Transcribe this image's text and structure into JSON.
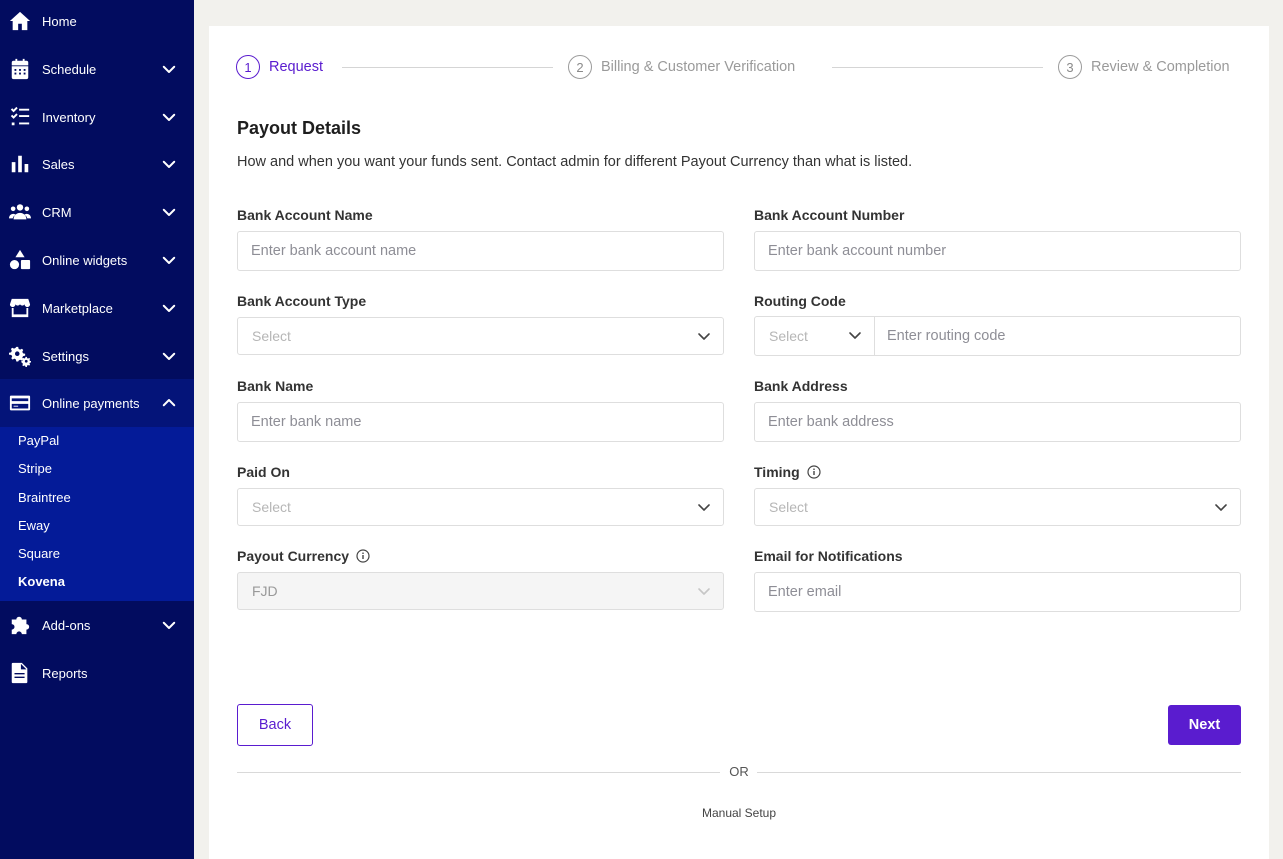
{
  "sidebar": {
    "items": [
      {
        "label": "Home",
        "icon": "home-icon"
      },
      {
        "label": "Schedule",
        "icon": "calendar-icon"
      },
      {
        "label": "Inventory",
        "icon": "checklist-icon"
      },
      {
        "label": "Sales",
        "icon": "bar-chart-icon"
      },
      {
        "label": "CRM",
        "icon": "users-icon"
      },
      {
        "label": "Online widgets",
        "icon": "shapes-icon"
      },
      {
        "label": "Marketplace",
        "icon": "store-icon"
      },
      {
        "label": "Settings",
        "icon": "gears-icon"
      },
      {
        "label": "Online payments",
        "icon": "credit-card-icon"
      },
      {
        "label": "Add-ons",
        "icon": "puzzle-icon"
      },
      {
        "label": "Reports",
        "icon": "document-icon"
      }
    ],
    "payments_submenu": [
      "PayPal",
      "Stripe",
      "Braintree",
      "Eway",
      "Square",
      "Kovena"
    ],
    "current_submenu_item": "Kovena"
  },
  "stepper": {
    "steps": [
      {
        "number": "1",
        "label": "Request",
        "active": true
      },
      {
        "number": "2",
        "label": "Billing & Customer Verification",
        "active": false
      },
      {
        "number": "3",
        "label": "Review & Completion",
        "active": false
      }
    ]
  },
  "form": {
    "title": "Payout Details",
    "subtitle": "How and when you want your funds sent. Contact admin for different Payout Currency than what is listed.",
    "bank_account_name": {
      "label": "Bank Account Name",
      "placeholder": "Enter bank account name"
    },
    "bank_account_number": {
      "label": "Bank Account Number",
      "placeholder": "Enter bank account number"
    },
    "bank_account_type": {
      "label": "Bank Account Type",
      "value": "Select"
    },
    "routing_code": {
      "label": "Routing Code",
      "select_value": "Select",
      "placeholder": "Enter routing code"
    },
    "bank_name": {
      "label": "Bank Name",
      "placeholder": "Enter bank name"
    },
    "bank_address": {
      "label": "Bank Address",
      "placeholder": "Enter bank address"
    },
    "paid_on": {
      "label": "Paid On",
      "value": "Select"
    },
    "timing": {
      "label": "Timing",
      "value": "Select"
    },
    "payout_currency": {
      "label": "Payout Currency",
      "value": "FJD"
    },
    "email": {
      "label": "Email for Notifications",
      "placeholder": "Enter email"
    }
  },
  "actions": {
    "back": "Back",
    "next": "Next",
    "or": "OR",
    "manual_setup": "Manual Setup"
  },
  "colors": {
    "sidebar_bg": "#020c5f",
    "submenu_bg": "#041b98",
    "accent": "#5a1ccf",
    "page_bg": "#f2f1ed"
  }
}
